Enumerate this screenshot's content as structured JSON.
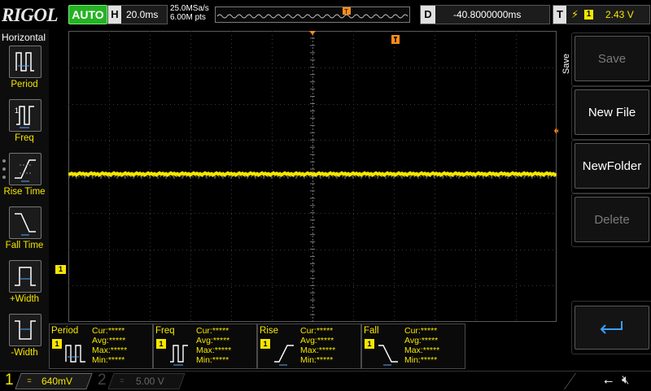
{
  "brand": "RIGOL",
  "run_mode": "AUTO",
  "horizontal": {
    "tag": "H",
    "timebase": "20.0ms",
    "sample_rate": "25.0MSa/s",
    "points": "6.00M pts"
  },
  "delay": {
    "tag": "D",
    "value": "-40.8000000ms"
  },
  "trigger": {
    "tag": "T",
    "edge_icon": "rising-edge-icon",
    "source": "1",
    "level": "2.43 V",
    "marker": "T"
  },
  "left_menu": {
    "title": "Horizontal",
    "items": [
      {
        "label": "Period",
        "icon": "period-icon"
      },
      {
        "label": "Freq",
        "icon": "freq-icon"
      },
      {
        "label": "Rise Time",
        "icon": "rise-time-icon"
      },
      {
        "label": "Fall Time",
        "icon": "fall-time-icon"
      },
      {
        "label": "+Width",
        "icon": "pos-width-icon"
      },
      {
        "label": "-Width",
        "icon": "neg-width-icon"
      }
    ]
  },
  "right_menu": {
    "title": "Save",
    "buttons": [
      {
        "label": "Save",
        "enabled": false
      },
      {
        "label": "New File",
        "enabled": true
      },
      {
        "label": "NewFolder",
        "enabled": true
      },
      {
        "label": "Delete",
        "enabled": false
      },
      {
        "label": "",
        "icon": "enter-arrow-icon",
        "enabled": true
      }
    ]
  },
  "channel_marker": "1",
  "measurements": [
    {
      "title": "Period",
      "source": "1",
      "icon": "period-icon",
      "cur": "Cur:*****",
      "avg": "Avg:*****",
      "max": "Max:*****",
      "min": "Min:*****"
    },
    {
      "title": "Freq",
      "source": "1",
      "icon": "freq-icon",
      "cur": "Cur:*****",
      "avg": "Avg:*****",
      "max": "Max:*****",
      "min": "Min:*****"
    },
    {
      "title": "Rise",
      "source": "1",
      "icon": "rise-time-icon",
      "cur": "Cur:*****",
      "avg": "Avg:*****",
      "max": "Max:*****",
      "min": "Min:*****"
    },
    {
      "title": "Fall",
      "source": "1",
      "icon": "fall-time-icon",
      "cur": "Cur:*****",
      "avg": "Avg:*****",
      "max": "Max:*****",
      "min": "Min:*****"
    }
  ],
  "channels": [
    {
      "num": "1",
      "coupling": "=",
      "scale": "640mV",
      "active": true
    },
    {
      "num": "2",
      "coupling": "=",
      "scale": "5.00 V",
      "active": false
    }
  ],
  "colors": {
    "ch1": "#f5e600",
    "ch2": "#666666",
    "run": "#25b225",
    "trigger_marker": "#ff8c1a",
    "grid": "#3a3a3a"
  }
}
